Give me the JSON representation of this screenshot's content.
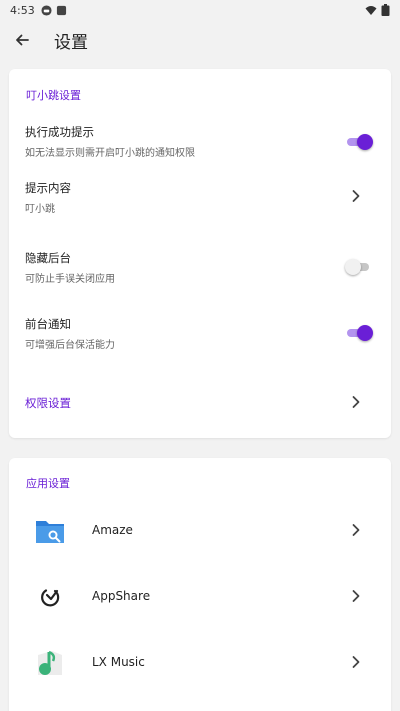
{
  "status_bar": {
    "time": "4:53"
  },
  "app_bar": {
    "title": "设置"
  },
  "section1": {
    "title": "叮小跳设置",
    "rows": [
      {
        "title": "执行成功提示",
        "subtitle": "如无法显示则需开启叮小跳的通知权限",
        "switch_on": true
      },
      {
        "title": "提示内容",
        "subtitle": "叮小跳"
      },
      {
        "title": "隐藏后台",
        "subtitle": "可防止手误关闭应用",
        "switch_on": false
      },
      {
        "title": "前台通知",
        "subtitle": "可增强后台保活能力",
        "switch_on": true
      }
    ],
    "permission_link": "权限设置"
  },
  "section2": {
    "title": "应用设置",
    "apps": [
      {
        "name": "Amaze",
        "icon": "folder-search-icon"
      },
      {
        "name": "AppShare",
        "icon": "appshare-icon"
      },
      {
        "name": "LX Music",
        "icon": "music-icon"
      }
    ]
  },
  "colors": {
    "accent": "#6a1fd6",
    "background": "#f2f2f2"
  }
}
